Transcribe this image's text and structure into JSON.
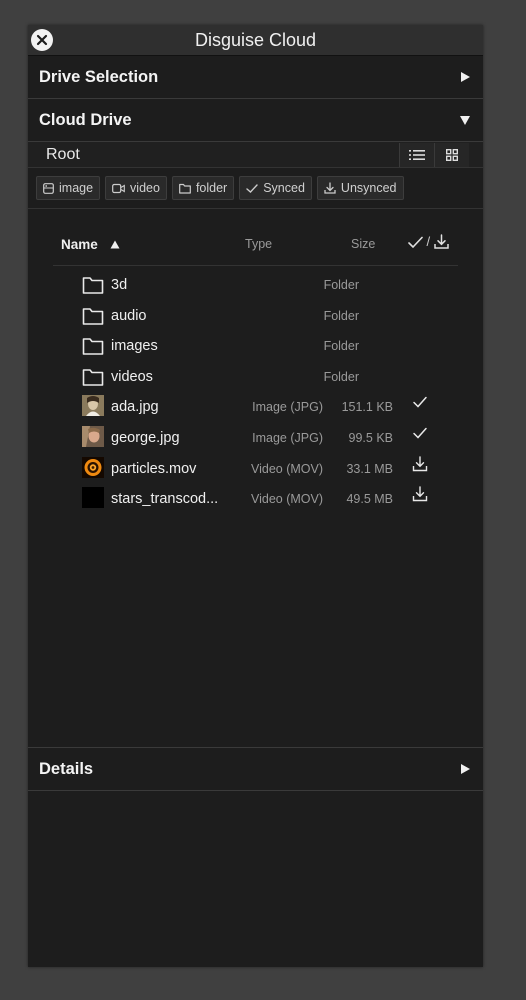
{
  "window": {
    "title": "Disguise Cloud"
  },
  "sections": {
    "drive_selection": {
      "label": "Drive Selection",
      "collapsed_icon": "triangle-right"
    },
    "cloud_drive": {
      "label": "Cloud Drive",
      "expanded_icon": "triangle-down"
    },
    "details": {
      "label": "Details",
      "collapsed_icon": "triangle-right"
    }
  },
  "breadcrumb": "Root",
  "view_modes": {
    "list": "list-icon",
    "grid": "grid-icon",
    "active": "list"
  },
  "filters": [
    {
      "label": "image",
      "icon": "image-icon"
    },
    {
      "label": "video",
      "icon": "video-icon"
    },
    {
      "label": "folder",
      "icon": "folder-icon"
    },
    {
      "label": "Synced",
      "icon": "check-icon"
    },
    {
      "label": "Unsynced",
      "icon": "download-icon"
    }
  ],
  "columns": {
    "name": "Name",
    "type": "Type",
    "size": "Size",
    "status_separator": "/",
    "sort": "ascending"
  },
  "files": [
    {
      "name": "3d",
      "type": "Folder",
      "size": "",
      "status": "",
      "kind": "folder"
    },
    {
      "name": "audio",
      "type": "Folder",
      "size": "",
      "status": "",
      "kind": "folder"
    },
    {
      "name": "images",
      "type": "Folder",
      "size": "",
      "status": "",
      "kind": "folder"
    },
    {
      "name": "videos",
      "type": "Folder",
      "size": "",
      "status": "",
      "kind": "folder"
    },
    {
      "name": "ada.jpg",
      "type": "Image (JPG)",
      "size": "151.1 KB",
      "status": "synced",
      "kind": "thumb-ada"
    },
    {
      "name": "george.jpg",
      "type": "Image (JPG)",
      "size": "99.5 KB",
      "status": "synced",
      "kind": "thumb-george"
    },
    {
      "name": "particles.mov",
      "type": "Video (MOV)",
      "size": "33.1 MB",
      "status": "unsynced",
      "kind": "thumb-particles"
    },
    {
      "name": "stars_transcod...",
      "type": "Video (MOV)",
      "size": "49.5 MB",
      "status": "unsynced",
      "kind": "thumb-stars"
    }
  ],
  "colors": {
    "background": "#404040",
    "panel": "#1d1d1d",
    "titlebar": "#2f2f2f",
    "text": "#f0f0f0",
    "muted": "#9a9a9a"
  }
}
